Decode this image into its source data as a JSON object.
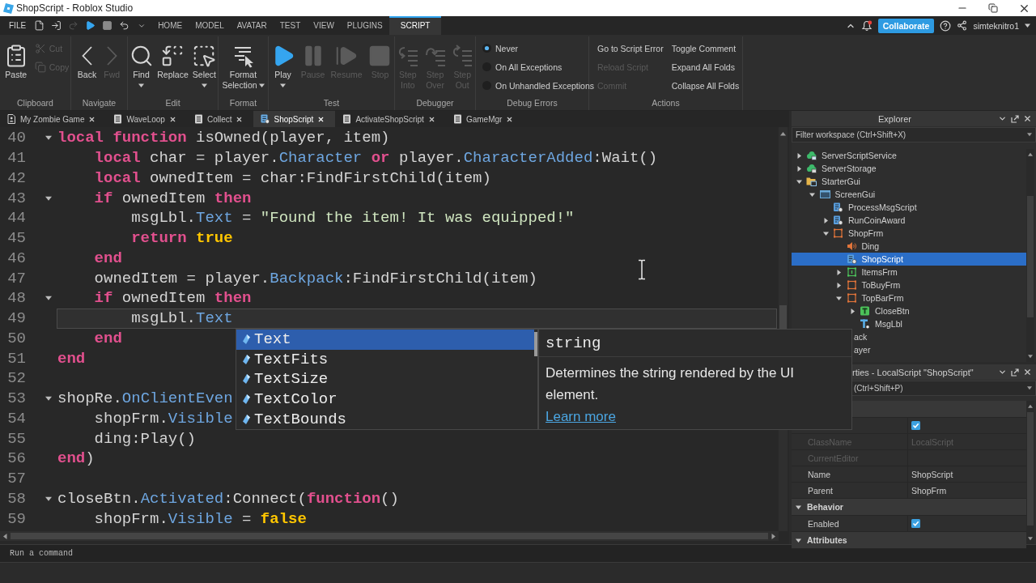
{
  "window": {
    "title": "ShopScript - Roblox Studio"
  },
  "menu_bar": {
    "file": "FILE",
    "quick_access": [
      {
        "kind": "new",
        "disabled": false
      },
      {
        "kind": "open",
        "disabled": false
      },
      {
        "kind": "redo",
        "disabled": true
      },
      {
        "kind": "play",
        "disabled": false
      },
      {
        "kind": "stop",
        "disabled": false
      },
      {
        "kind": "undo",
        "disabled": false
      },
      {
        "kind": "customize",
        "disabled": false
      }
    ],
    "tabs": [
      {
        "label": "HOME",
        "selected": false
      },
      {
        "label": "MODEL",
        "selected": false
      },
      {
        "label": "AVATAR",
        "selected": false
      },
      {
        "label": "TEST",
        "selected": false
      },
      {
        "label": "VIEW",
        "selected": false
      },
      {
        "label": "PLUGINS",
        "selected": false
      },
      {
        "label": "SCRIPT",
        "selected": true
      }
    ],
    "collaborate": "Collaborate",
    "user": "simteknitro1"
  },
  "ribbon": {
    "groups": [
      {
        "label": "Clipboard",
        "kind": "buttons",
        "buttons": [
          {
            "kind": "paste",
            "label": [
              "Paste"
            ],
            "disabled": false,
            "dropdown": false
          }
        ],
        "small_buttons": [
          {
            "kind": "cut",
            "label": "Cut",
            "disabled": true
          },
          {
            "kind": "copy",
            "label": "Copy",
            "disabled": true
          }
        ]
      },
      {
        "label": "Navigate",
        "kind": "buttons",
        "buttons": [
          {
            "kind": "back",
            "label": [
              "Back"
            ],
            "disabled": false,
            "dropdown": false
          },
          {
            "kind": "forward",
            "label": [
              "Fwd"
            ],
            "disabled": true,
            "dropdown": false
          }
        ]
      },
      {
        "label": "Edit",
        "kind": "buttons",
        "buttons": [
          {
            "kind": "find",
            "label": [
              "Find"
            ],
            "disabled": false,
            "dropdown": true
          },
          {
            "kind": "replace",
            "label": [
              "Replace"
            ],
            "disabled": false,
            "dropdown": false
          },
          {
            "kind": "select",
            "label": [
              "Select"
            ],
            "disabled": false,
            "dropdown": true
          }
        ]
      },
      {
        "label": "Format",
        "kind": "buttons",
        "buttons": [
          {
            "kind": "format",
            "label": [
              "Format",
              "Selection"
            ],
            "disabled": false,
            "dropdown": true
          }
        ]
      },
      {
        "label": "Test",
        "kind": "buttons",
        "buttons": [
          {
            "kind": "play",
            "label": [
              "Play"
            ],
            "disabled": false,
            "dropdown": true
          },
          {
            "kind": "pause",
            "label": [
              "Pause"
            ],
            "disabled": true,
            "dropdown": false
          },
          {
            "kind": "resume",
            "label": [
              "Resume"
            ],
            "disabled": true,
            "dropdown": false
          },
          {
            "kind": "stop",
            "label": [
              "Stop"
            ],
            "disabled": true,
            "dropdown": false
          }
        ]
      },
      {
        "label": "Debugger",
        "kind": "buttons",
        "buttons": [
          {
            "kind": "stepinto",
            "label": [
              "Step",
              "Into"
            ],
            "disabled": true,
            "dropdown": false
          },
          {
            "kind": "stepover",
            "label": [
              "Step",
              "Over"
            ],
            "disabled": true,
            "dropdown": false
          },
          {
            "kind": "stepout",
            "label": [
              "Step",
              "Out"
            ],
            "disabled": true,
            "dropdown": false
          }
        ]
      },
      {
        "label": "Debug Errors",
        "kind": "radios",
        "options": [
          {
            "label": "Never",
            "selected": true
          },
          {
            "label": "On All Exceptions",
            "selected": false
          },
          {
            "label": "On Unhandled Exceptions",
            "selected": false
          }
        ]
      },
      {
        "label": "Actions",
        "kind": "actions",
        "buttons": [
          {
            "label": "Go to Script Error",
            "disabled": false
          },
          {
            "label": "Reload Script",
            "disabled": true
          },
          {
            "label": "Commit",
            "disabled": true
          },
          {
            "label": "Toggle Comment",
            "disabled": false
          },
          {
            "label": "Expand All Folds",
            "disabled": false
          },
          {
            "label": "Collapse All Folds",
            "disabled": false
          }
        ]
      }
    ]
  },
  "script_tabs": [
    {
      "label": "My Zombie Game",
      "kind": "place",
      "selected": false
    },
    {
      "label": "WaveLoop",
      "kind": "script",
      "selected": false
    },
    {
      "label": "Collect",
      "kind": "script",
      "selected": false
    },
    {
      "label": "ShopScript",
      "kind": "localscript",
      "selected": true
    },
    {
      "label": "ActivateShopScript",
      "kind": "script",
      "selected": false
    },
    {
      "label": "GameMgr",
      "kind": "script",
      "selected": false
    }
  ],
  "editor": {
    "lines": [
      {
        "number": "40",
        "current": false,
        "expanded": true,
        "tokens": [
          {
            "kind": "keyword",
            "text": "local function"
          },
          {
            "kind": "plain",
            "text": " isOwned(player, item)"
          }
        ]
      },
      {
        "number": "41",
        "current": false,
        "tokens": [
          {
            "kind": "keyword",
            "text": "    local"
          },
          {
            "kind": "plain",
            "text": " char = player."
          },
          {
            "kind": "member",
            "text": "Character"
          },
          {
            "kind": "keyword",
            "text": " or"
          },
          {
            "kind": "plain",
            "text": " player."
          },
          {
            "kind": "member",
            "text": "CharacterAdded"
          },
          {
            "kind": "plain",
            "text": ":Wait()"
          }
        ]
      },
      {
        "number": "42",
        "current": false,
        "tokens": [
          {
            "kind": "keyword",
            "text": "    local"
          },
          {
            "kind": "plain",
            "text": " ownedItem = char:FindFirstChild(item)"
          }
        ]
      },
      {
        "number": "43",
        "current": false,
        "expanded": true,
        "tokens": [
          {
            "kind": "keyword",
            "text": "    if"
          },
          {
            "kind": "plain",
            "text": " ownedItem "
          },
          {
            "kind": "keyword",
            "text": "then"
          }
        ]
      },
      {
        "number": "44",
        "current": false,
        "tokens": [
          {
            "kind": "plain",
            "text": "        msgLbl."
          },
          {
            "kind": "member",
            "text": "Text"
          },
          {
            "kind": "plain",
            "text": " = "
          },
          {
            "kind": "string",
            "text": "\"Found the item! It was equipped!\""
          }
        ]
      },
      {
        "number": "45",
        "current": false,
        "tokens": [
          {
            "kind": "keyword",
            "text": "        return"
          },
          {
            "kind": "bool",
            "text": " true"
          }
        ]
      },
      {
        "number": "46",
        "current": false,
        "tokens": [
          {
            "kind": "keyword",
            "text": "    end"
          }
        ]
      },
      {
        "number": "47",
        "current": false,
        "tokens": [
          {
            "kind": "plain",
            "text": "    ownedItem = player."
          },
          {
            "kind": "member",
            "text": "Backpack"
          },
          {
            "kind": "plain",
            "text": ":FindFirstChild(item)"
          }
        ]
      },
      {
        "number": "48",
        "current": false,
        "expanded": true,
        "tokens": [
          {
            "kind": "keyword",
            "text": "    if"
          },
          {
            "kind": "plain",
            "text": " ownedItem "
          },
          {
            "kind": "keyword",
            "text": "then"
          }
        ]
      },
      {
        "number": "49",
        "current": true,
        "tokens": [
          {
            "kind": "plain",
            "text": "        msgLbl."
          },
          {
            "kind": "member",
            "text": "Text"
          }
        ]
      },
      {
        "number": "50",
        "current": false,
        "tokens": [
          {
            "kind": "keyword",
            "text": "    end"
          }
        ]
      },
      {
        "number": "51",
        "current": false,
        "tokens": [
          {
            "kind": "keyword",
            "text": "end"
          }
        ]
      },
      {
        "number": "52",
        "current": false
      },
      {
        "number": "53",
        "current": false,
        "expanded": true,
        "tokens": [
          {
            "kind": "plain",
            "text": "shopRe."
          },
          {
            "kind": "member",
            "text": "OnClientEven"
          }
        ]
      },
      {
        "number": "54",
        "current": false,
        "tokens": [
          {
            "kind": "plain",
            "text": "    shopFrm."
          },
          {
            "kind": "member",
            "text": "Visible"
          }
        ]
      },
      {
        "number": "55",
        "current": false,
        "tokens": [
          {
            "kind": "plain",
            "text": "    ding:Play()"
          }
        ]
      },
      {
        "number": "56",
        "current": false,
        "tokens": [
          {
            "kind": "keyword",
            "text": "end"
          },
          {
            "kind": "plain",
            "text": ")"
          }
        ]
      },
      {
        "number": "57",
        "current": false
      },
      {
        "number": "58",
        "current": false,
        "expanded": true,
        "tokens": [
          {
            "kind": "plain",
            "text": "closeBtn."
          },
          {
            "kind": "member",
            "text": "Activated"
          },
          {
            "kind": "plain",
            "text": ":Connect("
          },
          {
            "kind": "keyword",
            "text": "function"
          },
          {
            "kind": "plain",
            "text": "()"
          }
        ]
      },
      {
        "number": "59",
        "current": false,
        "tokens": [
          {
            "kind": "plain",
            "text": "    shopFrm."
          },
          {
            "kind": "member",
            "text": "Visible"
          },
          {
            "kind": "plain",
            "text": " = "
          },
          {
            "kind": "bool",
            "text": "false"
          }
        ]
      }
    ]
  },
  "autocomplete": {
    "items": [
      {
        "label": "Text",
        "selected": true
      },
      {
        "label": "TextFits",
        "selected": false
      },
      {
        "label": "TextSize",
        "selected": false
      },
      {
        "label": "TextColor",
        "selected": false
      },
      {
        "label": "TextBounds",
        "selected": false
      }
    ]
  },
  "tooltip": {
    "type": "string",
    "description": "Determines the string rendered by the UI element.",
    "link": "Learn more"
  },
  "explorer": {
    "title": "Explorer",
    "filter_placeholder": "Filter workspace (Ctrl+Shift+X)",
    "tree": [
      {
        "label": "ServerScriptService",
        "kind": "service",
        "expanded": false,
        "selected": false
      },
      {
        "label": "ServerStorage",
        "kind": "storage",
        "expanded": false,
        "selected": false
      },
      {
        "label": "StarterGui",
        "kind": "guifolder",
        "expanded": true,
        "selected": false,
        "children": [
          {
            "label": "ScreenGui",
            "kind": "screengui",
            "expanded": true,
            "selected": false,
            "children": [
              {
                "label": "ProcessMsgScript",
                "kind": "localscript",
                "selected": false
              },
              {
                "label": "RunCoinAward",
                "kind": "localscript",
                "expanded": false,
                "selected": false
              },
              {
                "label": "ShopFrm",
                "kind": "frame",
                "expanded": true,
                "selected": false,
                "children": [
                  {
                    "label": "Ding",
                    "kind": "sound",
                    "selected": false
                  },
                  {
                    "label": "ShopScript",
                    "kind": "localscript",
                    "selected": true
                  },
                  {
                    "label": "ItemsFrm",
                    "kind": "scrollingframe",
                    "expanded": false,
                    "selected": false
                  },
                  {
                    "label": "ToBuyFrm",
                    "kind": "frame",
                    "expanded": false,
                    "selected": false
                  },
                  {
                    "label": "TopBarFrm",
                    "kind": "frame",
                    "expanded": true,
                    "selected": false,
                    "children": [
                      {
                        "label": "CloseBtn",
                        "kind": "textbutton",
                        "expanded": false,
                        "selected": false
                      },
                      {
                        "label": "MsgLbl",
                        "kind": "textlabel",
                        "selected": false
                      }
                    ]
                  }
                ]
              }
            ]
          }
        ]
      },
      {
        "label": "ack",
        "kind": "covered",
        "selected": false
      },
      {
        "label": "ayer",
        "kind": "covered",
        "selected": false
      }
    ]
  },
  "properties": {
    "title": "rties - LocalScript \"ShopScript\"",
    "filter_placeholder": "(Ctrl+Shift+P)",
    "rows": [
      {
        "kind": "category"
      },
      {
        "kind": "property",
        "checked": true,
        "disabled": false
      },
      {
        "kind": "property",
        "name": "ClassName",
        "value": "LocalScript",
        "disabled": true
      },
      {
        "kind": "property",
        "name": "CurrentEditor",
        "disabled": true
      },
      {
        "kind": "property",
        "name": "Name",
        "value": "ShopScript",
        "disabled": false
      },
      {
        "kind": "property",
        "name": "Parent",
        "value": "ShopFrm",
        "disabled": false
      },
      {
        "kind": "category",
        "label": "Behavior",
        "expanded": true
      },
      {
        "kind": "property",
        "name": "Enabled",
        "checked": true,
        "disabled": false
      },
      {
        "kind": "category",
        "label": "Attributes",
        "expanded": true
      }
    ]
  },
  "command_bar": {
    "placeholder": "Run a command"
  }
}
